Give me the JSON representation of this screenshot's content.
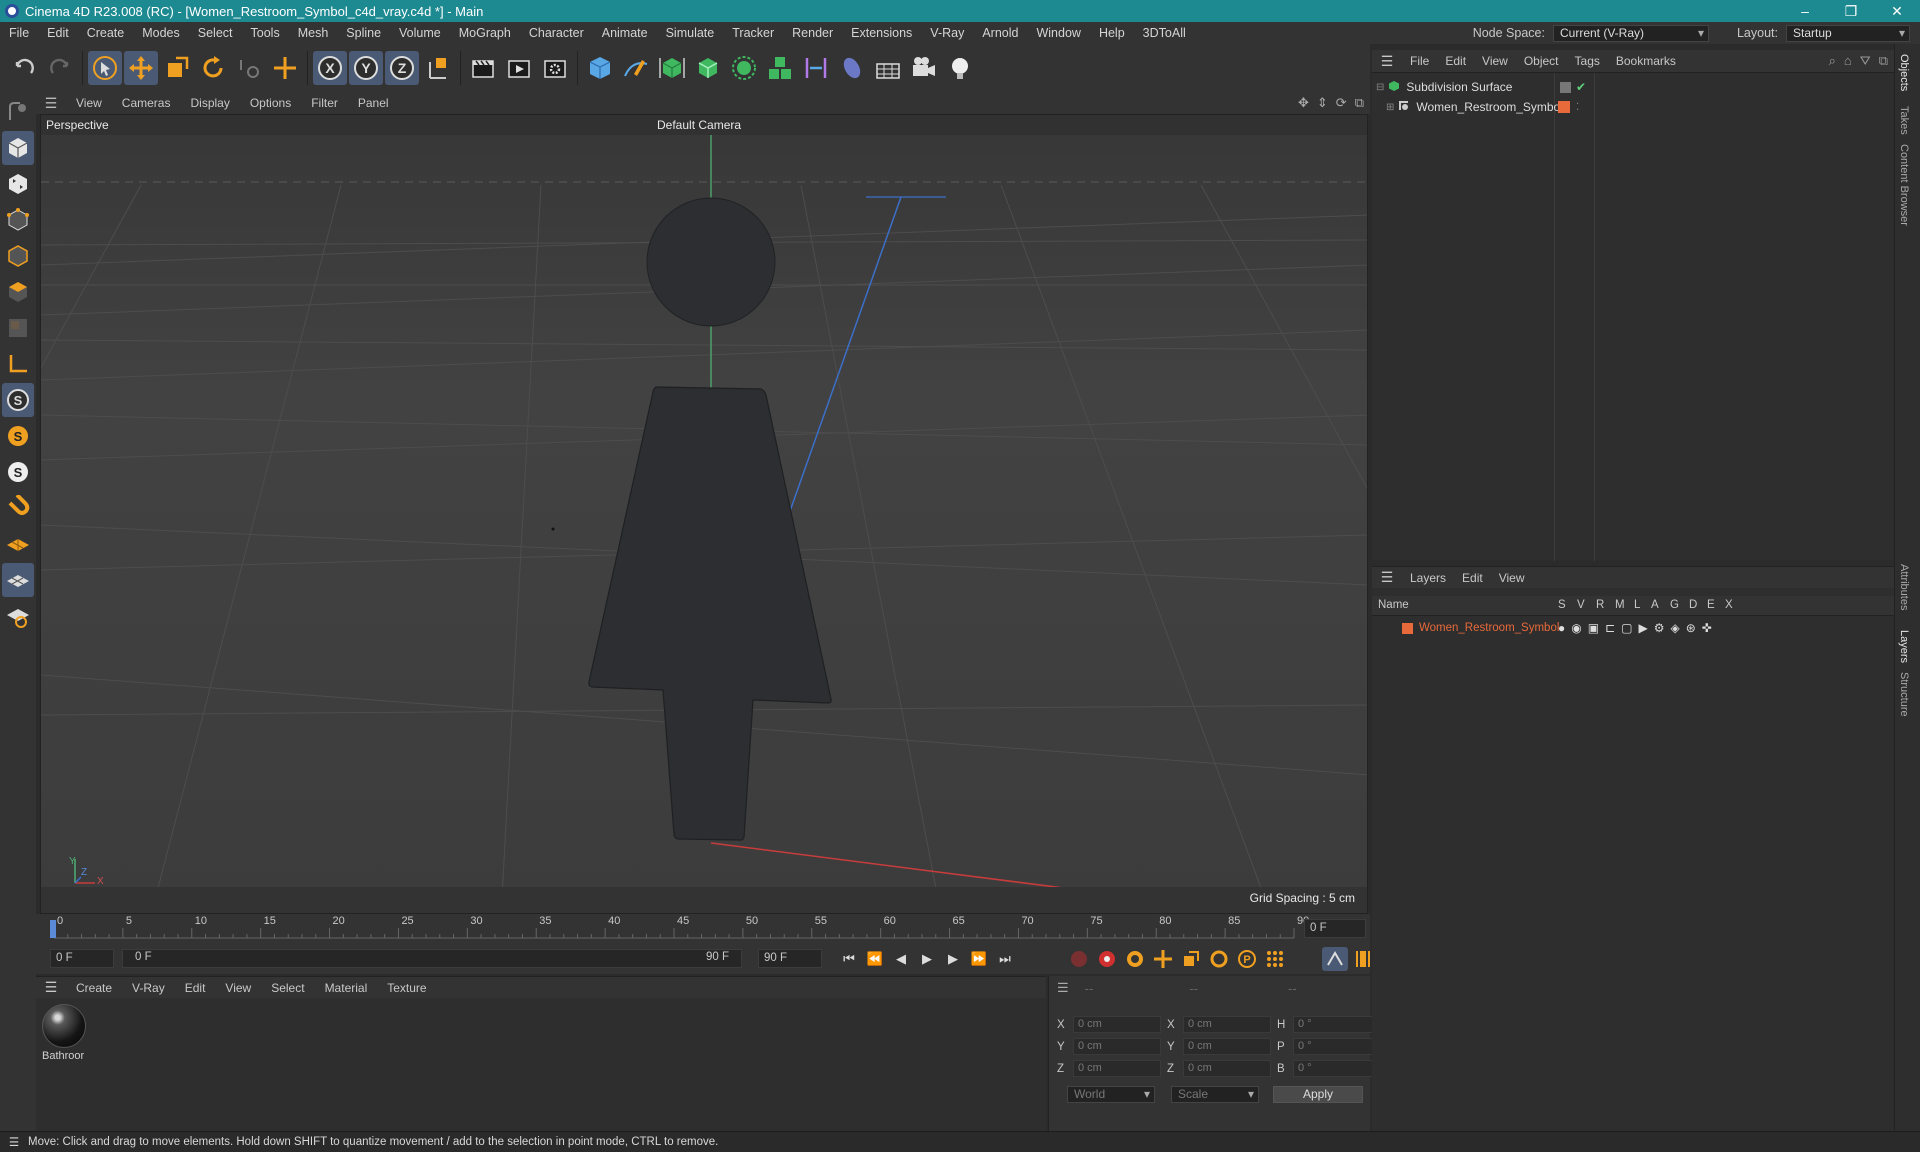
{
  "titlebar": {
    "title": "Cinema 4D R23.008 (RC) - [Women_Restroom_Symbol_c4d_vray.c4d *] - Main",
    "minimize": "–",
    "maximize": "❐",
    "close": "✕"
  },
  "menubar": {
    "items": [
      "File",
      "Edit",
      "Create",
      "Modes",
      "Select",
      "Tools",
      "Mesh",
      "Spline",
      "Volume",
      "MoGraph",
      "Character",
      "Animate",
      "Simulate",
      "Tracker",
      "Render",
      "Extensions",
      "V-Ray",
      "Arnold",
      "Window",
      "Help",
      "3DToAll"
    ],
    "node_space_label": "Node Space:",
    "node_space_value": "Current (V-Ray)",
    "layout_label": "Layout:",
    "layout_value": "Startup"
  },
  "viewport": {
    "menu": [
      "View",
      "Cameras",
      "Display",
      "Options",
      "Filter",
      "Panel"
    ],
    "view_name": "Perspective",
    "camera": "Default Camera",
    "grid_spacing": "Grid Spacing : 5 cm",
    "axis_y": "Y",
    "axis_z": "Z",
    "axis_x": "X"
  },
  "timeline": {
    "ticks": [
      "0",
      "5",
      "10",
      "15",
      "20",
      "25",
      "30",
      "35",
      "40",
      "45",
      "50",
      "55",
      "60",
      "65",
      "70",
      "75",
      "80",
      "85",
      "90"
    ],
    "current_frame_right": "0 F",
    "start_field": "0 F",
    "range_start": "0 F",
    "range_end": "90 F",
    "end_field": "90 F"
  },
  "material_manager": {
    "menu": [
      "Create",
      "V-Ray",
      "Edit",
      "View",
      "Select",
      "Material",
      "Texture"
    ],
    "materials": [
      {
        "name": "Bathroor"
      }
    ]
  },
  "coordinates": {
    "headers": [
      "--",
      "--",
      "--"
    ],
    "rows": [
      {
        "l1": "X",
        "v1": "0 cm",
        "l2": "X",
        "v2": "0 cm",
        "l3": "H",
        "v3": "0 °"
      },
      {
        "l1": "Y",
        "v1": "0 cm",
        "l2": "Y",
        "v2": "0 cm",
        "l3": "P",
        "v3": "0 °"
      },
      {
        "l1": "Z",
        "v1": "0 cm",
        "l2": "Z",
        "v2": "0 cm",
        "l3": "B",
        "v3": "0 °"
      }
    ],
    "space": "World",
    "mode": "Scale",
    "apply": "Apply"
  },
  "object_manager": {
    "menu": [
      "File",
      "Edit",
      "View",
      "Object",
      "Tags",
      "Bookmarks"
    ],
    "objects": [
      {
        "name": "Subdivision Surface"
      },
      {
        "name": "Women_Restroom_Symbol"
      }
    ]
  },
  "layer_manager": {
    "menu": [
      "Layers",
      "Edit",
      "View"
    ],
    "columns": [
      "Name",
      "S",
      "V",
      "R",
      "M",
      "L",
      "A",
      "G",
      "D",
      "E",
      "X"
    ],
    "layers": [
      {
        "name": "Women_Restroom_Symbol",
        "color": "#e8693a"
      }
    ]
  },
  "side_tabs": [
    "Objects",
    "Takes",
    "Content Browser",
    "Attributes",
    "Layers",
    "Structure"
  ],
  "statusbar": {
    "text": "Move: Click and drag to move elements. Hold down SHIFT to quantize movement / add to the selection in point mode, CTRL to remove."
  },
  "colors": {
    "accent": "#e8693a",
    "titlebar": "#1d8a92",
    "object_green": "#5fcf7a"
  }
}
